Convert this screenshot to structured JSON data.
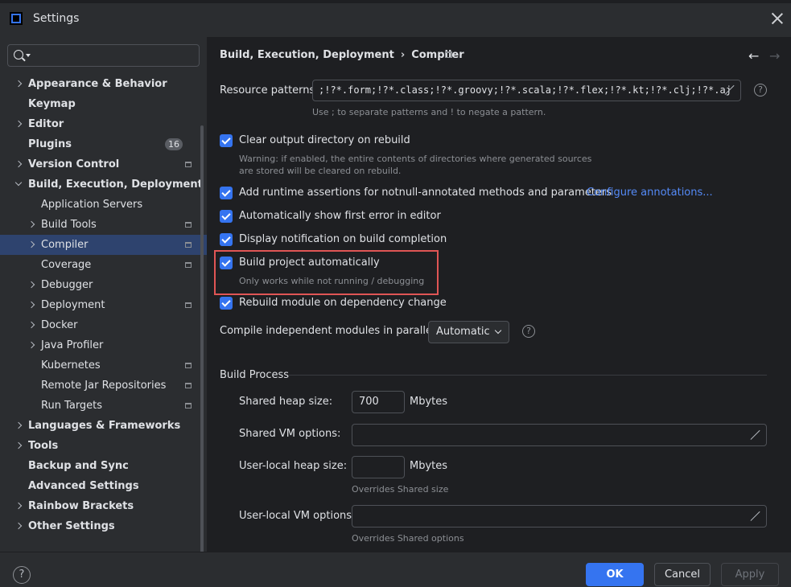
{
  "window": {
    "title": "Settings"
  },
  "search": {
    "placeholder": "",
    "value": ""
  },
  "sidebar": {
    "items": [
      {
        "label": "Appearance & Behavior",
        "bold": true,
        "indent": 0,
        "chevron": "closed",
        "pin": false
      },
      {
        "label": "Keymap",
        "bold": true,
        "indent": 0,
        "chevron": "none",
        "pin": false
      },
      {
        "label": "Editor",
        "bold": true,
        "indent": 0,
        "chevron": "closed",
        "pin": false
      },
      {
        "label": "Plugins",
        "bold": true,
        "indent": 0,
        "chevron": "none",
        "pin": false,
        "badge": "16"
      },
      {
        "label": "Version Control",
        "bold": true,
        "indent": 0,
        "chevron": "closed",
        "pin": true
      },
      {
        "label": "Build, Execution, Deployment",
        "bold": true,
        "indent": 0,
        "chevron": "open",
        "pin": false
      },
      {
        "label": "Application Servers",
        "bold": false,
        "indent": 1,
        "chevron": "none",
        "pin": false
      },
      {
        "label": "Build Tools",
        "bold": false,
        "indent": 1,
        "chevron": "closed",
        "pin": true
      },
      {
        "label": "Compiler",
        "bold": false,
        "indent": 1,
        "chevron": "closed",
        "pin": true,
        "selected": true
      },
      {
        "label": "Coverage",
        "bold": false,
        "indent": 1,
        "chevron": "none",
        "pin": true
      },
      {
        "label": "Debugger",
        "bold": false,
        "indent": 1,
        "chevron": "closed",
        "pin": false
      },
      {
        "label": "Deployment",
        "bold": false,
        "indent": 1,
        "chevron": "closed",
        "pin": true
      },
      {
        "label": "Docker",
        "bold": false,
        "indent": 1,
        "chevron": "closed",
        "pin": false
      },
      {
        "label": "Java Profiler",
        "bold": false,
        "indent": 1,
        "chevron": "closed",
        "pin": false
      },
      {
        "label": "Kubernetes",
        "bold": false,
        "indent": 1,
        "chevron": "none",
        "pin": true
      },
      {
        "label": "Remote Jar Repositories",
        "bold": false,
        "indent": 1,
        "chevron": "none",
        "pin": true
      },
      {
        "label": "Run Targets",
        "bold": false,
        "indent": 1,
        "chevron": "none",
        "pin": true
      },
      {
        "label": "Languages & Frameworks",
        "bold": true,
        "indent": 0,
        "chevron": "closed",
        "pin": false
      },
      {
        "label": "Tools",
        "bold": true,
        "indent": 0,
        "chevron": "closed",
        "pin": false
      },
      {
        "label": "Backup and Sync",
        "bold": true,
        "indent": 0,
        "chevron": "none",
        "pin": false
      },
      {
        "label": "Advanced Settings",
        "bold": true,
        "indent": 0,
        "chevron": "none",
        "pin": false
      },
      {
        "label": "Rainbow Brackets",
        "bold": true,
        "indent": 0,
        "chevron": "closed",
        "pin": false
      },
      {
        "label": "Other Settings",
        "bold": true,
        "indent": 0,
        "chevron": "closed",
        "pin": false
      }
    ]
  },
  "breadcrumb": {
    "parent": "Build, Execution, Deployment",
    "separator": "›",
    "current": "Compiler"
  },
  "resource_patterns": {
    "label": "Resource patterns:",
    "value": ";!?*.form;!?*.class;!?*.groovy;!?*.scala;!?*.flex;!?*.kt;!?*.clj;!?*.aj",
    "hint": "Use ; to separate patterns and ! to negate a pattern."
  },
  "options": {
    "clear_output": {
      "label": "Clear output directory on rebuild",
      "checked": true,
      "hint_line1": "Warning: if enabled, the entire contents of directories where generated sources",
      "hint_line2": "are stored will be cleared on rebuild."
    },
    "runtime_assertions": {
      "label": "Add runtime assertions for notnull-annotated methods and parameters",
      "checked": true,
      "link": "Configure annotations..."
    },
    "show_first_error": {
      "label": "Automatically show first error in editor",
      "checked": true
    },
    "display_notification": {
      "label": "Display notification on build completion",
      "checked": true
    },
    "build_auto": {
      "label": "Build project automatically",
      "checked": true,
      "hint": "Only works while not running / debugging"
    },
    "rebuild_module": {
      "label": "Rebuild module on dependency change",
      "checked": true
    }
  },
  "parallel": {
    "label": "Compile independent modules in parallel:",
    "value": "Automatic"
  },
  "build_process": {
    "title": "Build Process",
    "shared_heap_label": "Shared heap size:",
    "shared_heap_value": "700",
    "shared_heap_unit": "Mbytes",
    "shared_vm_label": "Shared VM options:",
    "shared_vm_value": "",
    "user_heap_label": "User-local heap size:",
    "user_heap_value": "",
    "user_heap_unit": "Mbytes",
    "user_heap_hint": "Overrides Shared size",
    "user_vm_label": "User-local VM options:",
    "user_vm_value": "",
    "user_vm_hint": "Overrides Shared options"
  },
  "footer": {
    "help": "?",
    "ok": "OK",
    "cancel": "Cancel",
    "apply": "Apply"
  },
  "colors": {
    "accent": "#3574f0",
    "highlight": "#e05555",
    "link": "#548af7",
    "selection": "#2e436e"
  }
}
